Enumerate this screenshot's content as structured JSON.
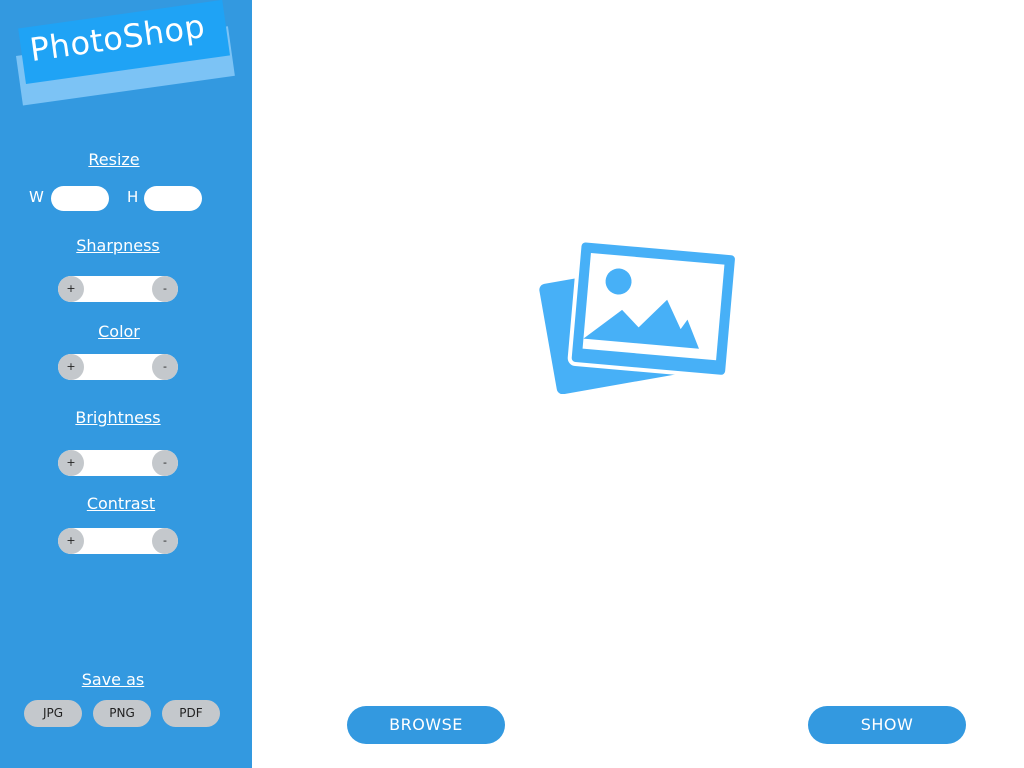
{
  "app": {
    "title": "PhotoShop"
  },
  "resize": {
    "label": "Resize",
    "width_label": "W",
    "height_label": "H",
    "width_value": "",
    "height_value": ""
  },
  "adjustments": [
    {
      "label": "Sharpness",
      "plus": "+",
      "minus": "-"
    },
    {
      "label": "Color",
      "plus": "+",
      "minus": "-"
    },
    {
      "label": "Brightness",
      "plus": "+",
      "minus": "-"
    },
    {
      "label": "Contrast",
      "plus": "+",
      "minus": "-"
    }
  ],
  "save": {
    "label": "Save as",
    "formats": [
      "JPG",
      "PNG",
      "PDF"
    ]
  },
  "actions": {
    "browse": "BROWSE",
    "show": "SHOW"
  },
  "colors": {
    "sidebar": "#3399e0",
    "logo": "#1fa3f5",
    "image_icon": "#47b0f7",
    "button_grey": "#c4c8cc"
  },
  "icons": {
    "placeholder": "image-placeholder-icon"
  }
}
